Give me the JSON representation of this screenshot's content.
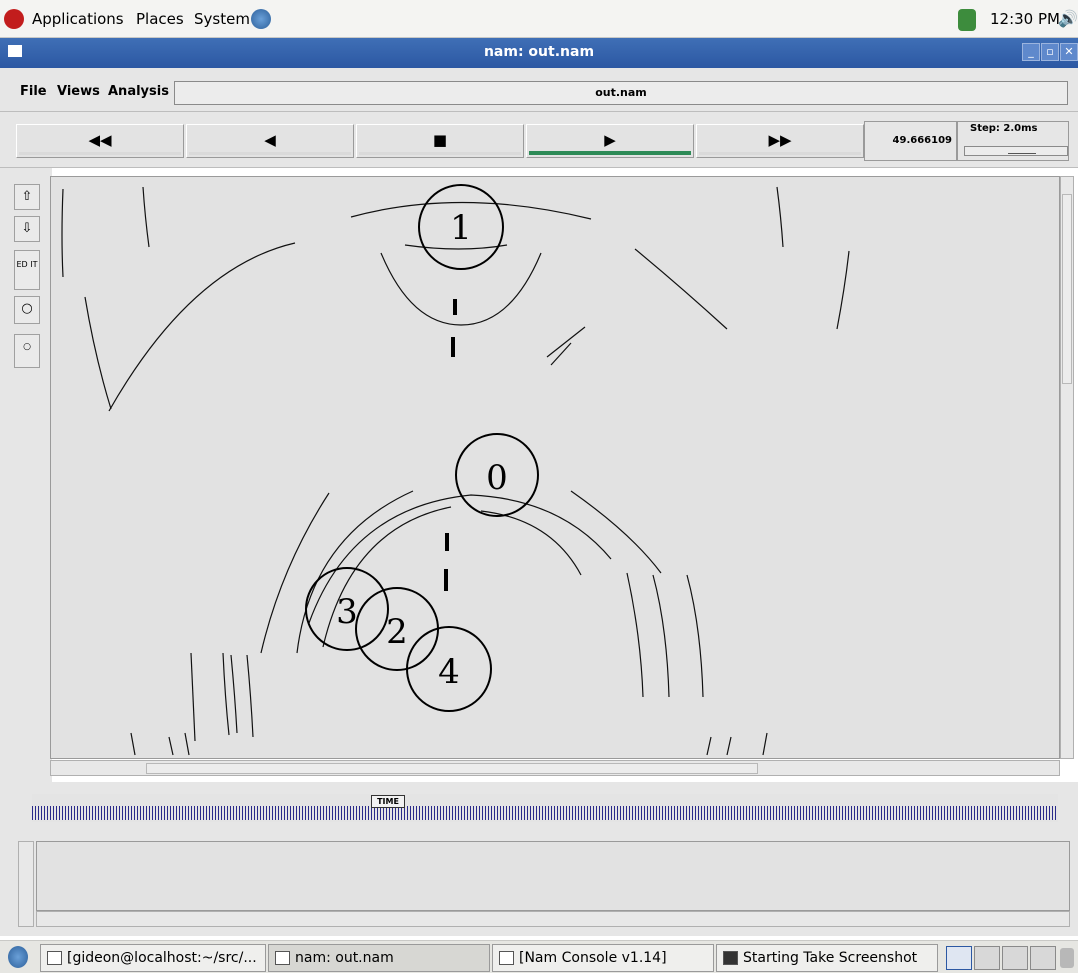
{
  "top_panel": {
    "menus": [
      "Applications",
      "Places",
      "System"
    ],
    "clock": "12:30 PM"
  },
  "window": {
    "title": "nam: out.nam"
  },
  "menubar": {
    "items": [
      "File",
      "Views",
      "Analysis"
    ],
    "file_display": "out.nam"
  },
  "transport": {
    "buttons": [
      "◀◀",
      "◀",
      "■",
      "▶",
      "▶▶"
    ],
    "active_button": "▶",
    "current_time": "49.666109",
    "step_label": "Step: 2.0ms"
  },
  "left_tools": {
    "edit_label": "ED IT"
  },
  "topology": {
    "node_labels": [
      "0",
      "1",
      "2",
      "3",
      "4"
    ]
  },
  "timeline": {
    "label": "TIME"
  },
  "taskbar": {
    "tasks": [
      "[gideon@localhost:~/src/...",
      "nam: out.nam",
      "[Nam Console v1.14]",
      "Starting Take Screenshot"
    ]
  },
  "colors": {
    "title_bar": "#2c58a3",
    "active_play": "#2e8b57",
    "timeline_ticks": "#2a2a8a"
  }
}
